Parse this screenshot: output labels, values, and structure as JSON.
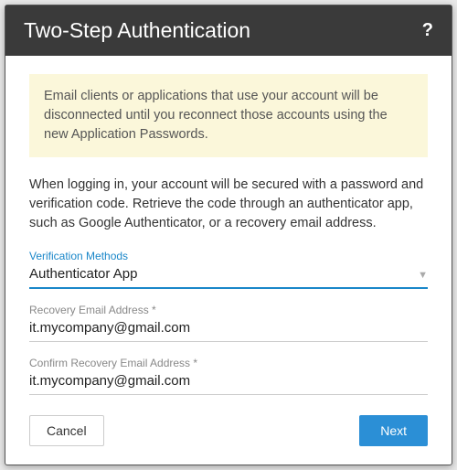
{
  "header": {
    "title": "Two-Step Authentication",
    "help": "?"
  },
  "notice": "Email clients or applications that use your account will be disconnected until you reconnect those accounts using the new Application Passwords.",
  "description": "When logging in, your account will be secured with a password and verification code. Retrieve the code through an authenticator app, such as Google Authenticator, or a recovery email address.",
  "fields": {
    "method": {
      "label": "Verification Methods",
      "value": "Authenticator App"
    },
    "recovery": {
      "label": "Recovery Email Address *",
      "value": "it.mycompany@gmail.com"
    },
    "confirm": {
      "label": "Confirm Recovery Email Address *",
      "value": "it.mycompany@gmail.com"
    }
  },
  "buttons": {
    "cancel": "Cancel",
    "next": "Next"
  }
}
